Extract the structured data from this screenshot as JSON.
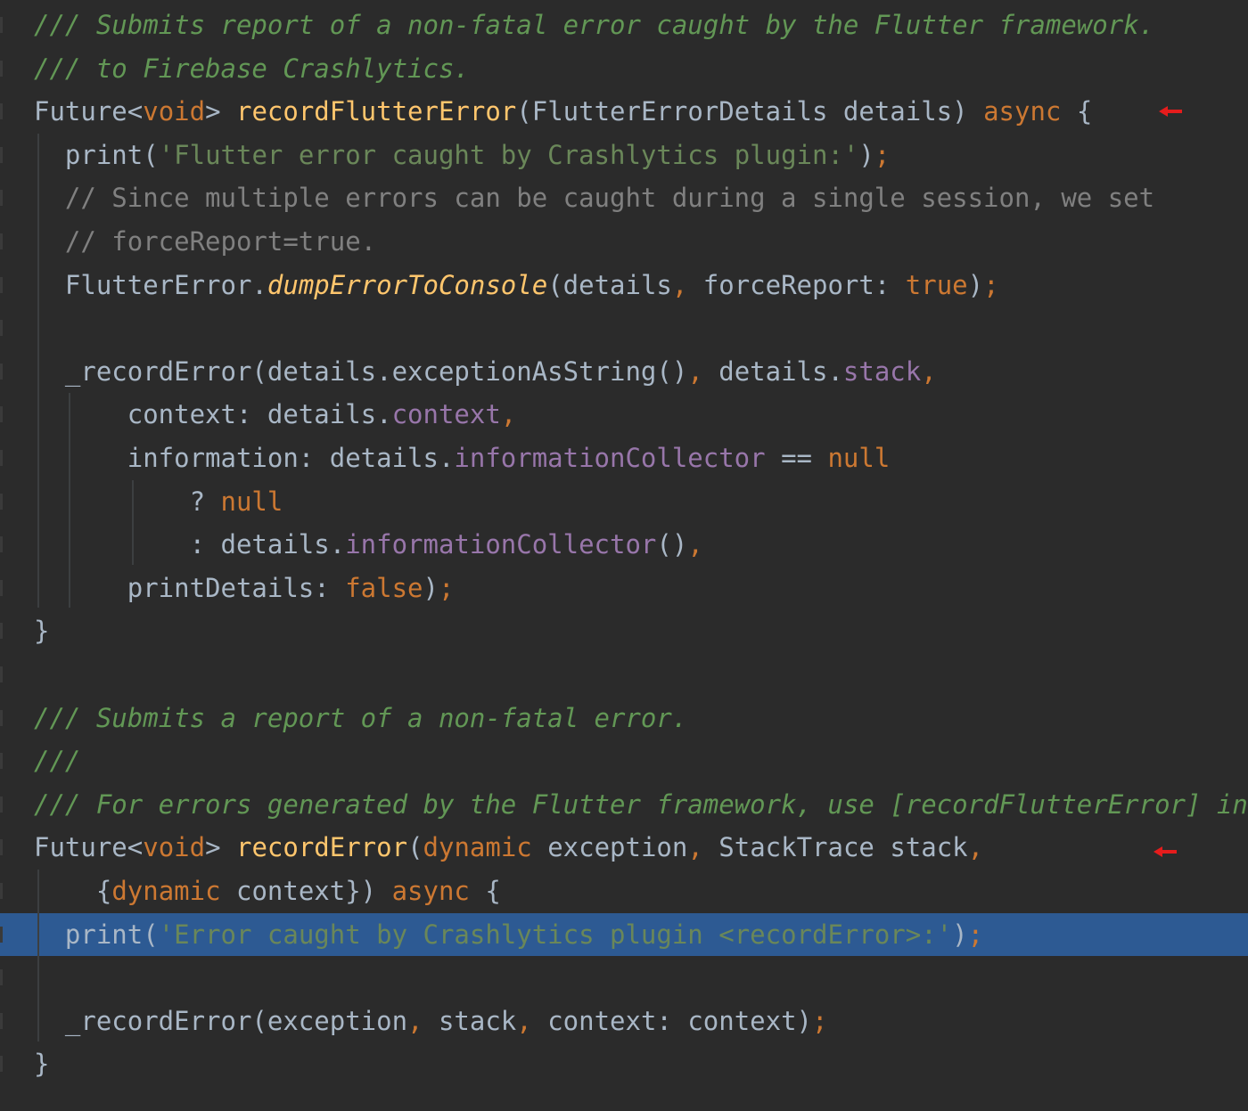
{
  "colors": {
    "background": "#2b2b2b",
    "selection": "#2d5a93",
    "doc_comment": "#629755",
    "keyword": "#cc7832",
    "function": "#ffc66d",
    "string": "#6a8759",
    "comment": "#808080",
    "field": "#9876aa",
    "text": "#a9b7c6",
    "arrow": "#e51c1c"
  },
  "markers": {
    "arrow_icon": "red-left-arrow"
  },
  "lines": [
    {
      "tokens": [
        {
          "t": "/// Submits report of a non-fatal error caught by the Flutter framework.",
          "c": "doc"
        }
      ]
    },
    {
      "tokens": [
        {
          "t": "/// to Firebase Crashlytics.",
          "c": "doc"
        }
      ]
    },
    {
      "tokens": [
        {
          "t": "Future",
          "c": "plain"
        },
        {
          "t": "<",
          "c": "plain"
        },
        {
          "t": "void",
          "c": "kw"
        },
        {
          "t": "> ",
          "c": "plain"
        },
        {
          "t": "recordFlutterError",
          "c": "fn"
        },
        {
          "t": "(FlutterErrorDetails details) ",
          "c": "plain"
        },
        {
          "t": "async",
          "c": "kw"
        },
        {
          "t": " {",
          "c": "plain"
        }
      ]
    },
    {
      "tokens": [
        {
          "t": "  print(",
          "c": "plain"
        },
        {
          "t": "'Flutter error caught by Crashlytics plugin:'",
          "c": "str"
        },
        {
          "t": ")",
          "c": "plain"
        },
        {
          "t": ";",
          "c": "kw"
        }
      ]
    },
    {
      "tokens": [
        {
          "t": "  // Since multiple errors can be caught during a single session, we set",
          "c": "comment"
        }
      ]
    },
    {
      "tokens": [
        {
          "t": "  // forceReport=true.",
          "c": "comment"
        }
      ]
    },
    {
      "tokens": [
        {
          "t": "  FlutterError.",
          "c": "plain"
        },
        {
          "t": "dumpErrorToConsole",
          "c": "fnitalic"
        },
        {
          "t": "(details",
          "c": "plain"
        },
        {
          "t": ", ",
          "c": "kw"
        },
        {
          "t": "forceReport: ",
          "c": "plain"
        },
        {
          "t": "true",
          "c": "kw"
        },
        {
          "t": ")",
          "c": "plain"
        },
        {
          "t": ";",
          "c": "kw"
        }
      ]
    },
    {
      "tokens": []
    },
    {
      "tokens": [
        {
          "t": "  _recordError(details.exceptionAsString()",
          "c": "plain"
        },
        {
          "t": ", ",
          "c": "kw"
        },
        {
          "t": "details.",
          "c": "plain"
        },
        {
          "t": "stack",
          "c": "field"
        },
        {
          "t": ",",
          "c": "kw"
        }
      ]
    },
    {
      "tokens": [
        {
          "t": "      context: details.",
          "c": "plain"
        },
        {
          "t": "context",
          "c": "field"
        },
        {
          "t": ",",
          "c": "kw"
        }
      ]
    },
    {
      "tokens": [
        {
          "t": "      information: details.",
          "c": "plain"
        },
        {
          "t": "informationCollector",
          "c": "field"
        },
        {
          "t": " == ",
          "c": "plain"
        },
        {
          "t": "null",
          "c": "kw"
        }
      ]
    },
    {
      "tokens": [
        {
          "t": "          ? ",
          "c": "plain"
        },
        {
          "t": "null",
          "c": "kw"
        }
      ]
    },
    {
      "tokens": [
        {
          "t": "          : details.",
          "c": "plain"
        },
        {
          "t": "informationCollector",
          "c": "field"
        },
        {
          "t": "()",
          "c": "plain"
        },
        {
          "t": ",",
          "c": "kw"
        }
      ]
    },
    {
      "tokens": [
        {
          "t": "      printDetails: ",
          "c": "plain"
        },
        {
          "t": "false",
          "c": "kw"
        },
        {
          "t": ")",
          "c": "plain"
        },
        {
          "t": ";",
          "c": "kw"
        }
      ]
    },
    {
      "tokens": [
        {
          "t": "}",
          "c": "plain"
        }
      ]
    },
    {
      "tokens": []
    },
    {
      "tokens": [
        {
          "t": "/// Submits a report of a non-fatal error.",
          "c": "doc"
        }
      ]
    },
    {
      "tokens": [
        {
          "t": "///",
          "c": "doc"
        }
      ]
    },
    {
      "tokens": [
        {
          "t": "/// For errors generated by the Flutter framework, use [recordFlutterError] in",
          "c": "doc"
        }
      ]
    },
    {
      "tokens": [
        {
          "t": "Future",
          "c": "plain"
        },
        {
          "t": "<",
          "c": "plain"
        },
        {
          "t": "void",
          "c": "kw"
        },
        {
          "t": "> ",
          "c": "plain"
        },
        {
          "t": "recordError",
          "c": "fn"
        },
        {
          "t": "(",
          "c": "plain"
        },
        {
          "t": "dynamic",
          "c": "kw"
        },
        {
          "t": " exception",
          "c": "plain"
        },
        {
          "t": ", ",
          "c": "kw"
        },
        {
          "t": "StackTrace stack",
          "c": "plain"
        },
        {
          "t": ",",
          "c": "kw"
        }
      ]
    },
    {
      "tokens": [
        {
          "t": "    {",
          "c": "plain"
        },
        {
          "t": "dynamic",
          "c": "kw"
        },
        {
          "t": " context}) ",
          "c": "plain"
        },
        {
          "t": "async",
          "c": "kw"
        },
        {
          "t": " {",
          "c": "plain"
        }
      ]
    },
    {
      "tokens": [
        {
          "t": "  print(",
          "c": "plain"
        },
        {
          "t": "'Error caught by Crashlytics plugin <recordError>:'",
          "c": "str"
        },
        {
          "t": ")",
          "c": "plain"
        },
        {
          "t": ";",
          "c": "kw"
        }
      ]
    },
    {
      "tokens": []
    },
    {
      "tokens": [
        {
          "t": "  _recordError(exception",
          "c": "plain"
        },
        {
          "t": ", ",
          "c": "kw"
        },
        {
          "t": "stack",
          "c": "plain"
        },
        {
          "t": ", ",
          "c": "kw"
        },
        {
          "t": "context: context)",
          "c": "plain"
        },
        {
          "t": ";",
          "c": "kw"
        }
      ]
    },
    {
      "tokens": [
        {
          "t": "}",
          "c": "plain"
        }
      ]
    }
  ]
}
